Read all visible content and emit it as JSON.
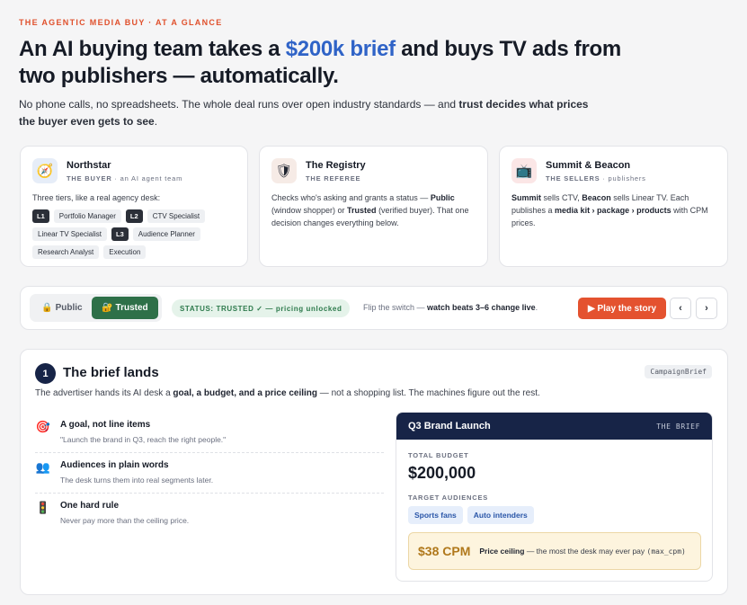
{
  "eyebrow": "THE AGENTIC MEDIA BUY · AT A GLANCE",
  "headline": {
    "part1": "An AI buying team takes a ",
    "highlight": "$200k brief",
    "part2": " and buys TV ads from two publishers — automatically."
  },
  "subline": {
    "text": "No phone calls, no spreadsheets. The whole deal runs over open industry standards — and ",
    "bold": "trust decides what prices the buyer even gets to see",
    "end": "."
  },
  "cards": {
    "buyer": {
      "icon": "compass-icon",
      "title": "Northstar",
      "role": "THE BUYER",
      "role_suffix": " · an AI agent team",
      "intro": "Three tiers, like a real agency desk:",
      "tiers": [
        {
          "level": "L1",
          "roles": [
            "Portfolio Manager"
          ]
        },
        {
          "level": "L2",
          "roles": [
            "CTV Specialist",
            "Linear TV Specialist"
          ]
        },
        {
          "level": "L3",
          "roles": [
            "Audience Planner",
            "Research Analyst",
            "Execution"
          ]
        }
      ]
    },
    "registry": {
      "icon": "shield-icon",
      "title": "The Registry",
      "role": "THE REFEREE",
      "t1": "Checks who's asking and grants a status — ",
      "b1": "Public",
      "t2": " (window shopper) or ",
      "b2": "Trusted",
      "t3": " (verified buyer). That one decision changes everything below."
    },
    "sellers": {
      "icon": "tv-icon",
      "title": "Summit & Beacon",
      "role": "THE SELLERS",
      "role_suffix": " · publishers",
      "b1": "Summit",
      "t1": " sells CTV, ",
      "b2": "Beacon",
      "t2": " sells Linear TV. Each publishes a ",
      "b3": "media kit › package › products",
      "t3": " with CPM prices."
    }
  },
  "controls": {
    "public_label": "🔒 Public",
    "trusted_label": "🔐 Trusted",
    "status": "STATUS: TRUSTED ✓ — pricing unlocked",
    "flip_text": "Flip the switch — ",
    "flip_bold": "watch beats 3–6 change live",
    "flip_end": ".",
    "play_label": "▶ Play the story",
    "prev": "‹",
    "next": "›"
  },
  "step": {
    "number": "1",
    "title": "The brief lands",
    "tag": "CampaignBrief",
    "desc1": "The advertiser hands its AI desk a ",
    "desc_bold": "goal, a budget, and a price ceiling",
    "desc2": " — not a shopping list. The machines figure out the rest.",
    "points": [
      {
        "icon": "target-icon",
        "glyph": "🎯",
        "title": "A goal, not line items",
        "text": "\"Launch the brand in Q3, reach the right people.\""
      },
      {
        "icon": "people-icon",
        "glyph": "👥",
        "title": "Audiences in plain words",
        "text": "The desk turns them into real segments later."
      },
      {
        "icon": "traffic-light-icon",
        "glyph": "🚦",
        "title": "One hard rule",
        "text": "Never pay more than the ceiling price."
      }
    ]
  },
  "brief": {
    "title": "Q3 Brand Launch",
    "tag": "THE BRIEF",
    "budget_label": "TOTAL BUDGET",
    "budget": "$200,000",
    "audiences_label": "TARGET AUDIENCES",
    "audiences": [
      "Sports fans",
      "Auto intenders"
    ],
    "cpm": "$38 CPM",
    "ceiling_bold": "Price ceiling",
    "ceiling_text": " — the most the desk may ever pay ",
    "ceiling_code": "(max_cpm)"
  }
}
